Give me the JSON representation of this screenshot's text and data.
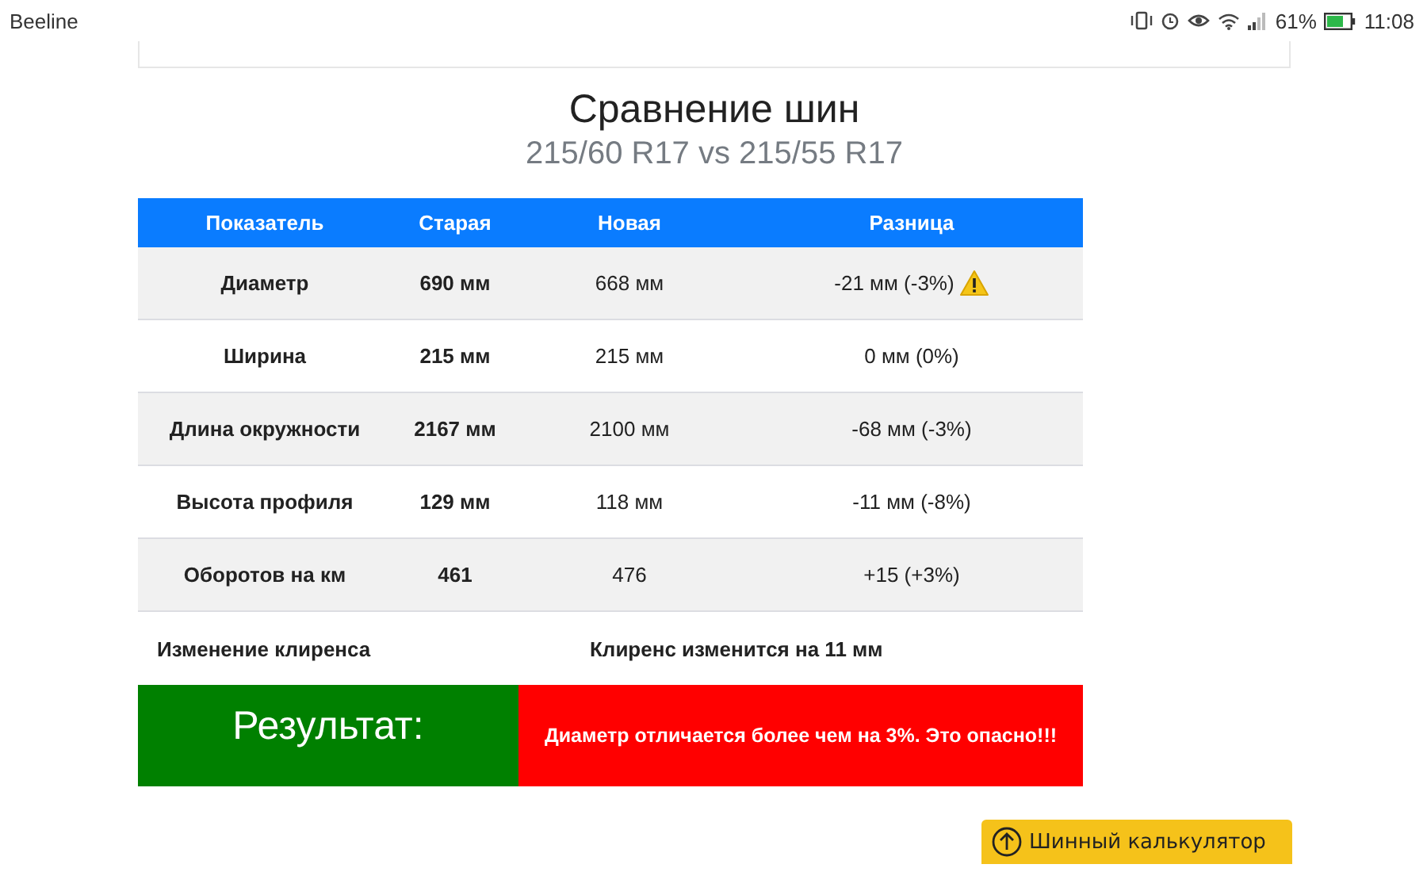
{
  "status_bar": {
    "carrier": "Beeline",
    "battery": "61%",
    "time": "11:08"
  },
  "title": "Сравнение шин",
  "subtitle": "215/60 R17 vs 215/55 R17",
  "table": {
    "columns": [
      "Показатель",
      "Старая",
      "Новая",
      "Разница"
    ],
    "rows": [
      {
        "name": "Диаметр",
        "old": "690 мм",
        "new": "668 мм",
        "diff": "-21 мм (-3%)",
        "warning": true
      },
      {
        "name": "Ширина",
        "old": "215 мм",
        "new": "215 мм",
        "diff": "0 мм (0%)",
        "warning": false
      },
      {
        "name": "Длина окружности",
        "old": "2167 мм",
        "new": "2100 мм",
        "diff": "-68 мм (-3%)",
        "warning": false
      },
      {
        "name": "Высота профиля",
        "old": "129 мм",
        "new": "118 мм",
        "diff": "-11 мм (-8%)",
        "warning": false
      },
      {
        "name": "Оборотов на км",
        "old": "461",
        "new": "476",
        "diff": "+15 (+3%)",
        "warning": false
      }
    ]
  },
  "clearance": {
    "label": "Изменение клиренса",
    "value": "Клиренс изменится на 11 мм"
  },
  "result": {
    "label": "Результат:",
    "message": "Диаметр отличается более чем на 3%. Это опасно!!!"
  },
  "calculator_button": "Шинный калькулятор"
}
